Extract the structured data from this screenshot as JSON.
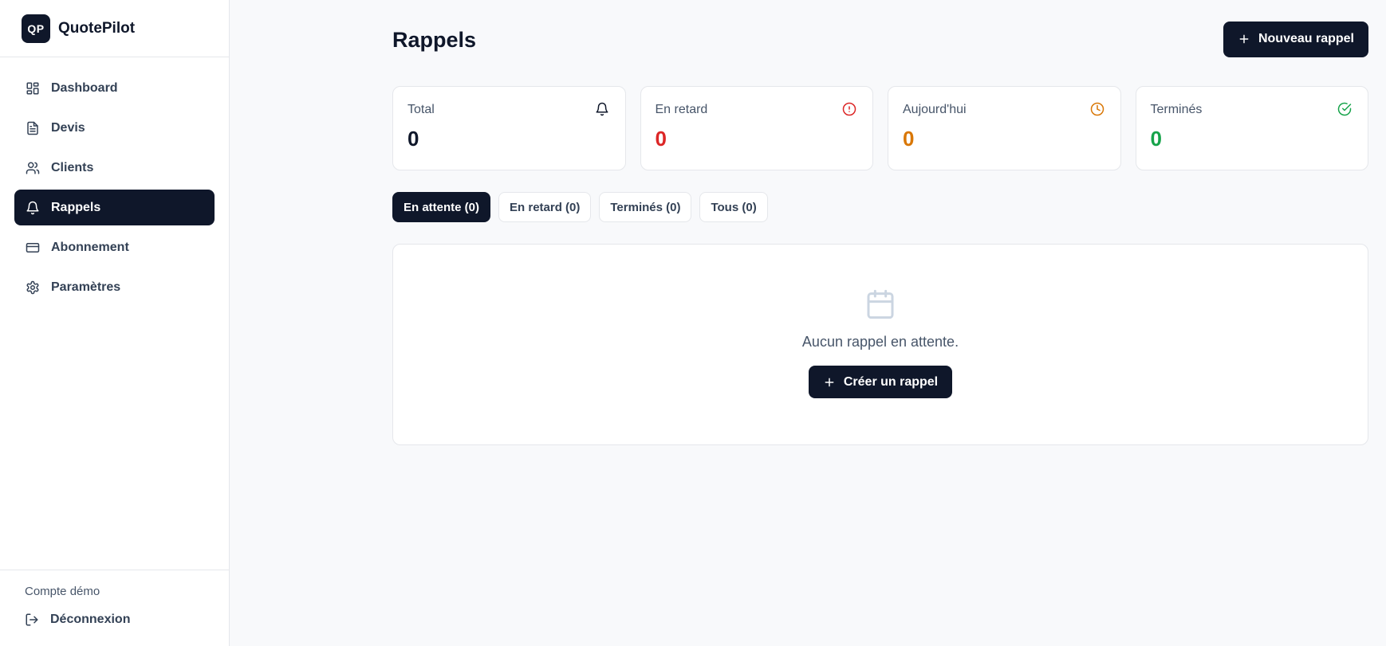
{
  "brand": {
    "logo_text": "QP",
    "name": "QuotePilot"
  },
  "sidebar": {
    "items": [
      {
        "label": "Dashboard",
        "icon": "dashboard-icon",
        "active": false
      },
      {
        "label": "Devis",
        "icon": "document-icon",
        "active": false
      },
      {
        "label": "Clients",
        "icon": "users-icon",
        "active": false
      },
      {
        "label": "Rappels",
        "icon": "bell-icon",
        "active": true
      },
      {
        "label": "Abonnement",
        "icon": "credit-card-icon",
        "active": false
      },
      {
        "label": "Paramètres",
        "icon": "gear-icon",
        "active": false
      }
    ],
    "account": "Compte démo",
    "logout": "Déconnexion"
  },
  "header": {
    "title": "Rappels",
    "new_button": "Nouveau rappel"
  },
  "stats": [
    {
      "label": "Total",
      "value": "0",
      "icon": "bell-icon",
      "color": "#0f172a"
    },
    {
      "label": "En retard",
      "value": "0",
      "icon": "alert-circle-icon",
      "color": "#dc2626"
    },
    {
      "label": "Aujourd'hui",
      "value": "0",
      "icon": "clock-icon",
      "color": "#d97706"
    },
    {
      "label": "Terminés",
      "value": "0",
      "icon": "check-circle-icon",
      "color": "#16a34a"
    }
  ],
  "tabs": [
    {
      "label": "En attente (0)",
      "active": true
    },
    {
      "label": "En retard (0)",
      "active": false
    },
    {
      "label": "Terminés (0)",
      "active": false
    },
    {
      "label": "Tous (0)",
      "active": false
    }
  ],
  "empty_state": {
    "icon": "calendar-icon",
    "message": "Aucun rappel en attente.",
    "button": "Créer un rappel"
  }
}
